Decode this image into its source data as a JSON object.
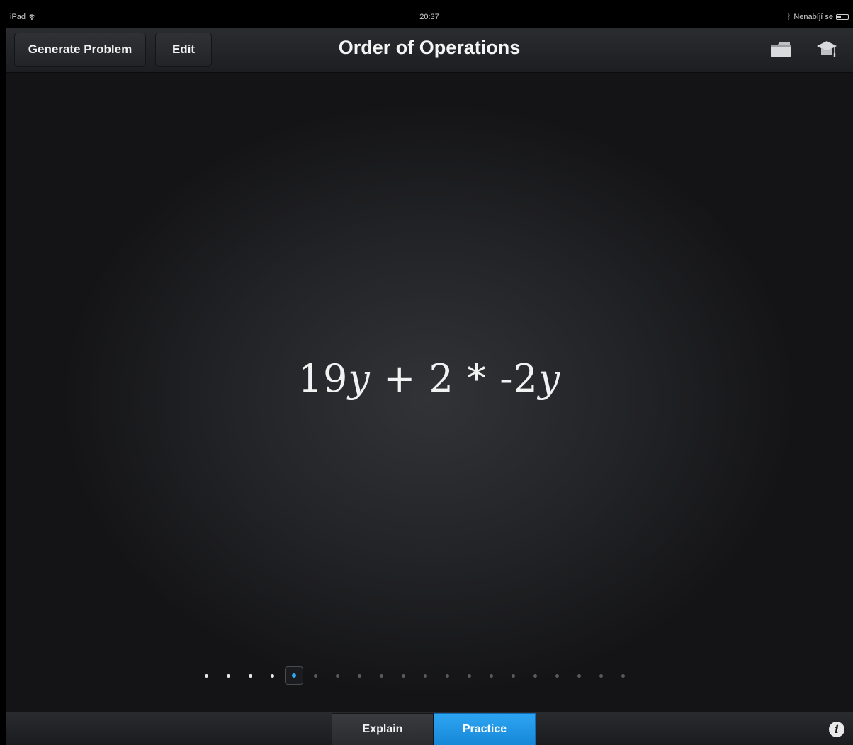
{
  "status_bar": {
    "device": "iPad",
    "time": "20:37",
    "charging_status": "Nenabíjí se",
    "icons": [
      "wifi-icon",
      "bluetooth-icon",
      "battery-icon"
    ]
  },
  "nav": {
    "generate_label": "Generate Problem",
    "edit_label": "Edit",
    "title": "Order of Operations",
    "icons": [
      "folder-icon",
      "graduation-cap-icon"
    ]
  },
  "problem": {
    "parts": [
      {
        "text": "19",
        "italic": false
      },
      {
        "text": "y",
        "italic": true
      },
      {
        "text": " + ",
        "italic": false
      },
      {
        "text": "2",
        "italic": false
      },
      {
        "text": " * ",
        "italic": false
      },
      {
        "text": "-2",
        "italic": false
      },
      {
        "text": "y",
        "italic": true
      }
    ]
  },
  "pagination": {
    "total": 20,
    "current_index": 4,
    "completed": 4
  },
  "tabs": {
    "explain_label": "Explain",
    "practice_label": "Practice",
    "selected": "Practice"
  },
  "info_label": "i",
  "colors": {
    "accent": "#2ea8f0",
    "background": "#222326",
    "bar": "#1d1e21"
  }
}
